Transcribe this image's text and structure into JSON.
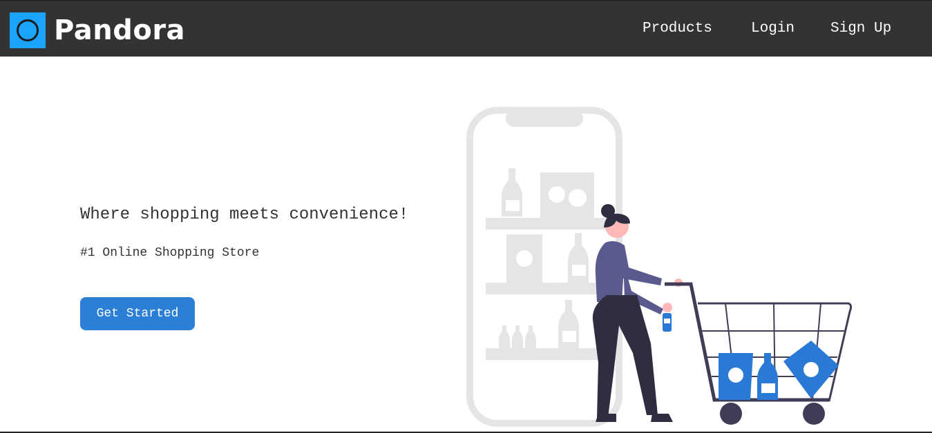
{
  "navbar": {
    "brand": "Pandora",
    "links": [
      {
        "label": "Products"
      },
      {
        "label": "Login"
      },
      {
        "label": "Sign Up"
      }
    ]
  },
  "hero": {
    "heading": "Where shopping meets convenience!",
    "subheading": "#1 Online Shopping Store",
    "cta_label": "Get Started"
  },
  "colors": {
    "navbar_bg": "#333333",
    "logo_accent": "#1aa3ff",
    "cta_bg": "#2b7fd6",
    "illustration_accent": "#2a7ad5"
  },
  "icons": {
    "logo": "circle-logo-icon"
  }
}
